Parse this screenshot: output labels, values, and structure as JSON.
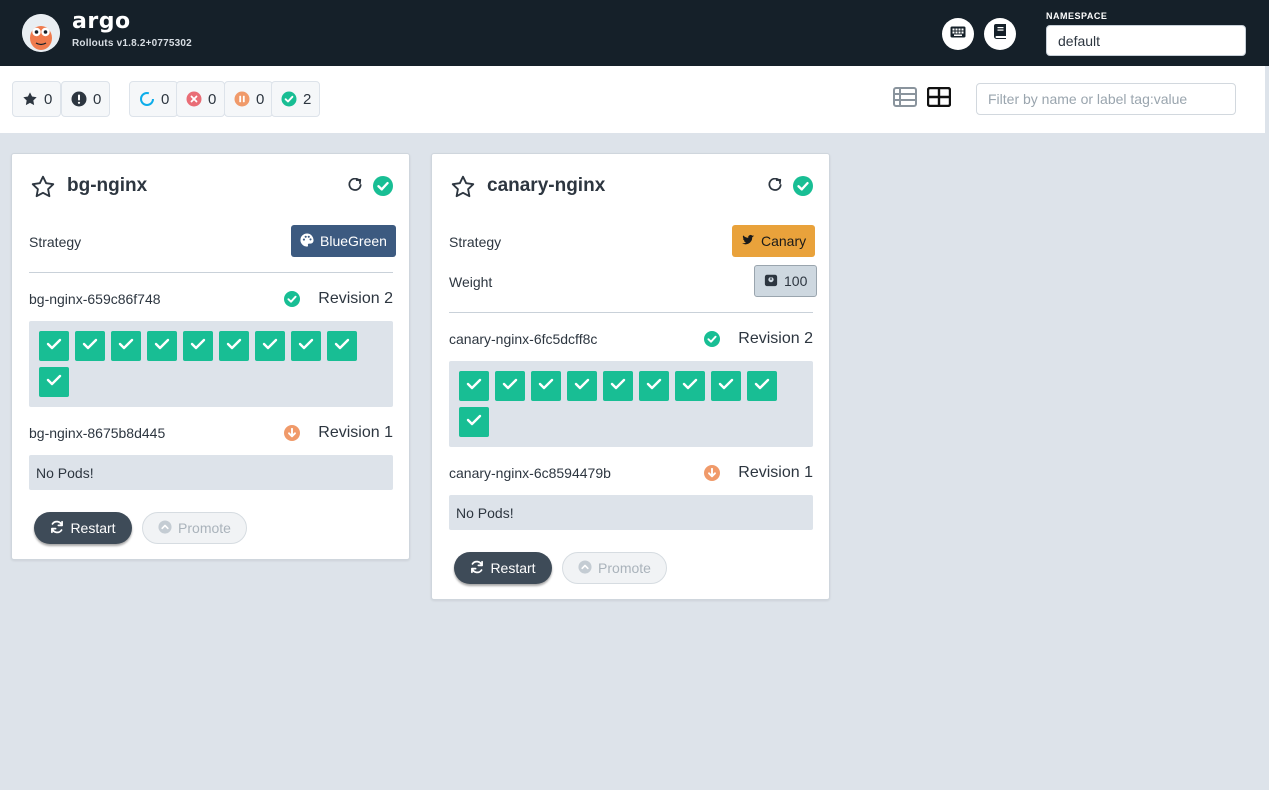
{
  "header": {
    "brand": "argo",
    "version": "Rollouts v1.8.2+0775302",
    "namespace_label": "NAMESPACE",
    "namespace_value": "default",
    "icons": [
      "keyboard-icon",
      "book-icon"
    ]
  },
  "toolbar": {
    "filters": [
      {
        "name": "favorites",
        "icon": "star-icon",
        "count": "0"
      },
      {
        "name": "needs-attention",
        "icon": "exclamation-icon",
        "count": "0"
      },
      {
        "name": "progressing",
        "icon": "spinner-icon",
        "count": "0"
      },
      {
        "name": "degraded",
        "icon": "error-icon",
        "count": "0"
      },
      {
        "name": "paused",
        "icon": "pause-icon",
        "count": "0"
      },
      {
        "name": "healthy",
        "icon": "check-icon",
        "count": "2"
      }
    ],
    "view_modes": [
      "list-view-icon",
      "grid-view-icon"
    ],
    "active_view": "grid",
    "search_placeholder": "Filter by name or label tag:value"
  },
  "rollouts": [
    {
      "name": "bg-nginx",
      "strategy_label": "Strategy",
      "strategy": "BlueGreen",
      "replica_sets": [
        {
          "name": "bg-nginx-659c86f748",
          "status": "healthy",
          "revision": "Revision 2",
          "pod_count": 10
        },
        {
          "name": "bg-nginx-8675b8d445",
          "status": "scaled-down",
          "revision": "Revision 1",
          "pods_text": "No Pods!"
        }
      ],
      "restart_label": "Restart",
      "promote_label": "Promote"
    },
    {
      "name": "canary-nginx",
      "strategy_label": "Strategy",
      "strategy": "Canary",
      "weight_label": "Weight",
      "weight": "100",
      "replica_sets": [
        {
          "name": "canary-nginx-6fc5dcff8c",
          "status": "healthy",
          "revision": "Revision 2",
          "pod_count": 10
        },
        {
          "name": "canary-nginx-6c8594479b",
          "status": "scaled-down",
          "revision": "Revision 1",
          "pods_text": "No Pods!"
        }
      ],
      "restart_label": "Restart",
      "promote_label": "Promote"
    }
  ],
  "colors": {
    "header_bg": "#152029",
    "healthy": "#18be94",
    "degraded": "#e96d76",
    "paused": "#f09a6a",
    "progressing": "#0dadea",
    "bluegreen": "#3c5a80",
    "canary": "#e9a23b",
    "restart": "#3e4b58"
  }
}
